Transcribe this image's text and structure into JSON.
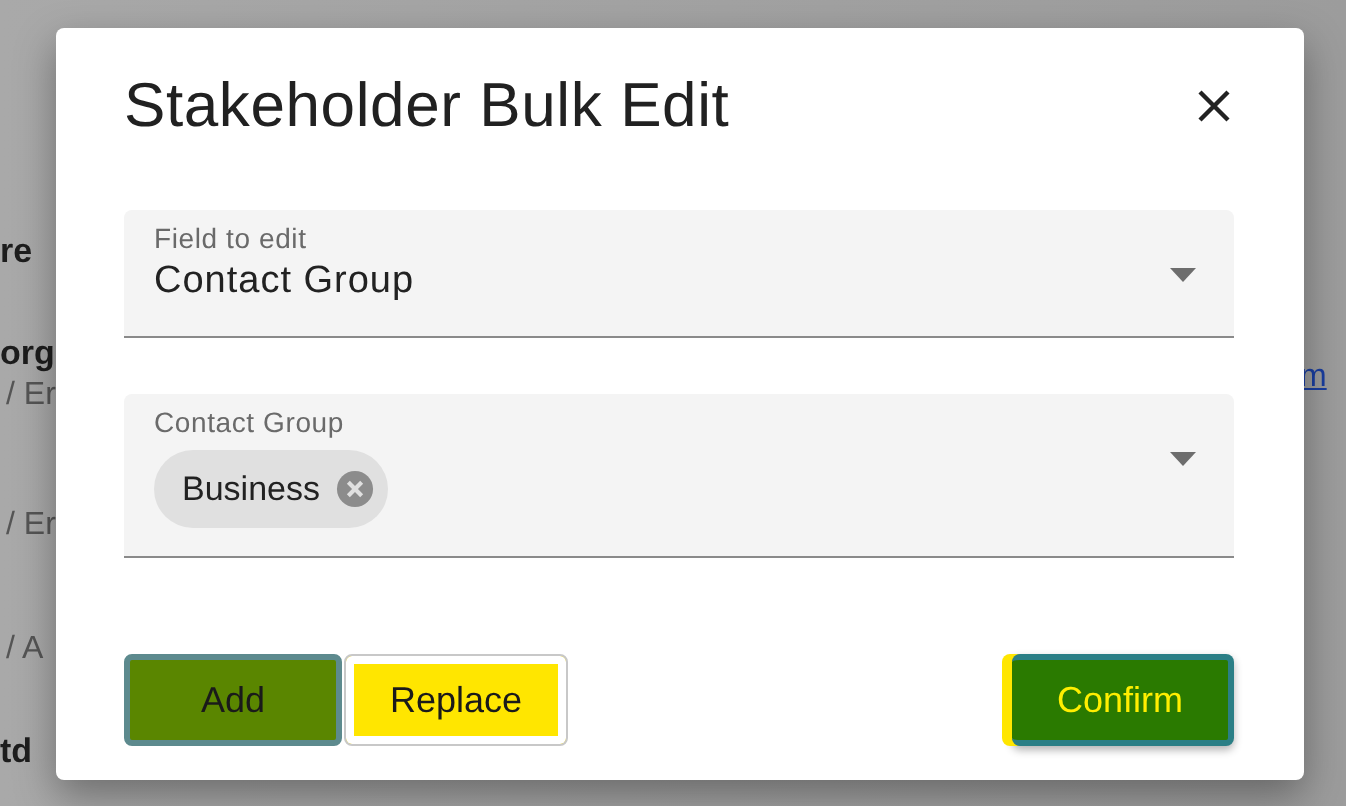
{
  "background_page": {
    "left_fragments": [
      {
        "text": "re",
        "kind": "heading"
      },
      {
        "text": "org",
        "kind": "heading"
      },
      {
        "text": "/ Er",
        "kind": "detail"
      },
      {
        "text": "/ Er",
        "kind": "detail"
      },
      {
        "text": "/ A",
        "kind": "detail"
      },
      {
        "text": "td",
        "kind": "heading"
      }
    ],
    "link": "m"
  },
  "dialog": {
    "title": "Stakeholder Bulk Edit",
    "fields": [
      {
        "kind": "select",
        "label": "Field to edit",
        "value": "Contact Group"
      },
      {
        "kind": "chips",
        "label": "Contact Group",
        "chips": [
          "Business"
        ]
      }
    ],
    "buttons": [
      {
        "label": "Add",
        "kind": "filled"
      },
      {
        "label": "Replace",
        "kind": "outlined"
      },
      {
        "label": "Confirm",
        "kind": "primary"
      }
    ]
  }
}
